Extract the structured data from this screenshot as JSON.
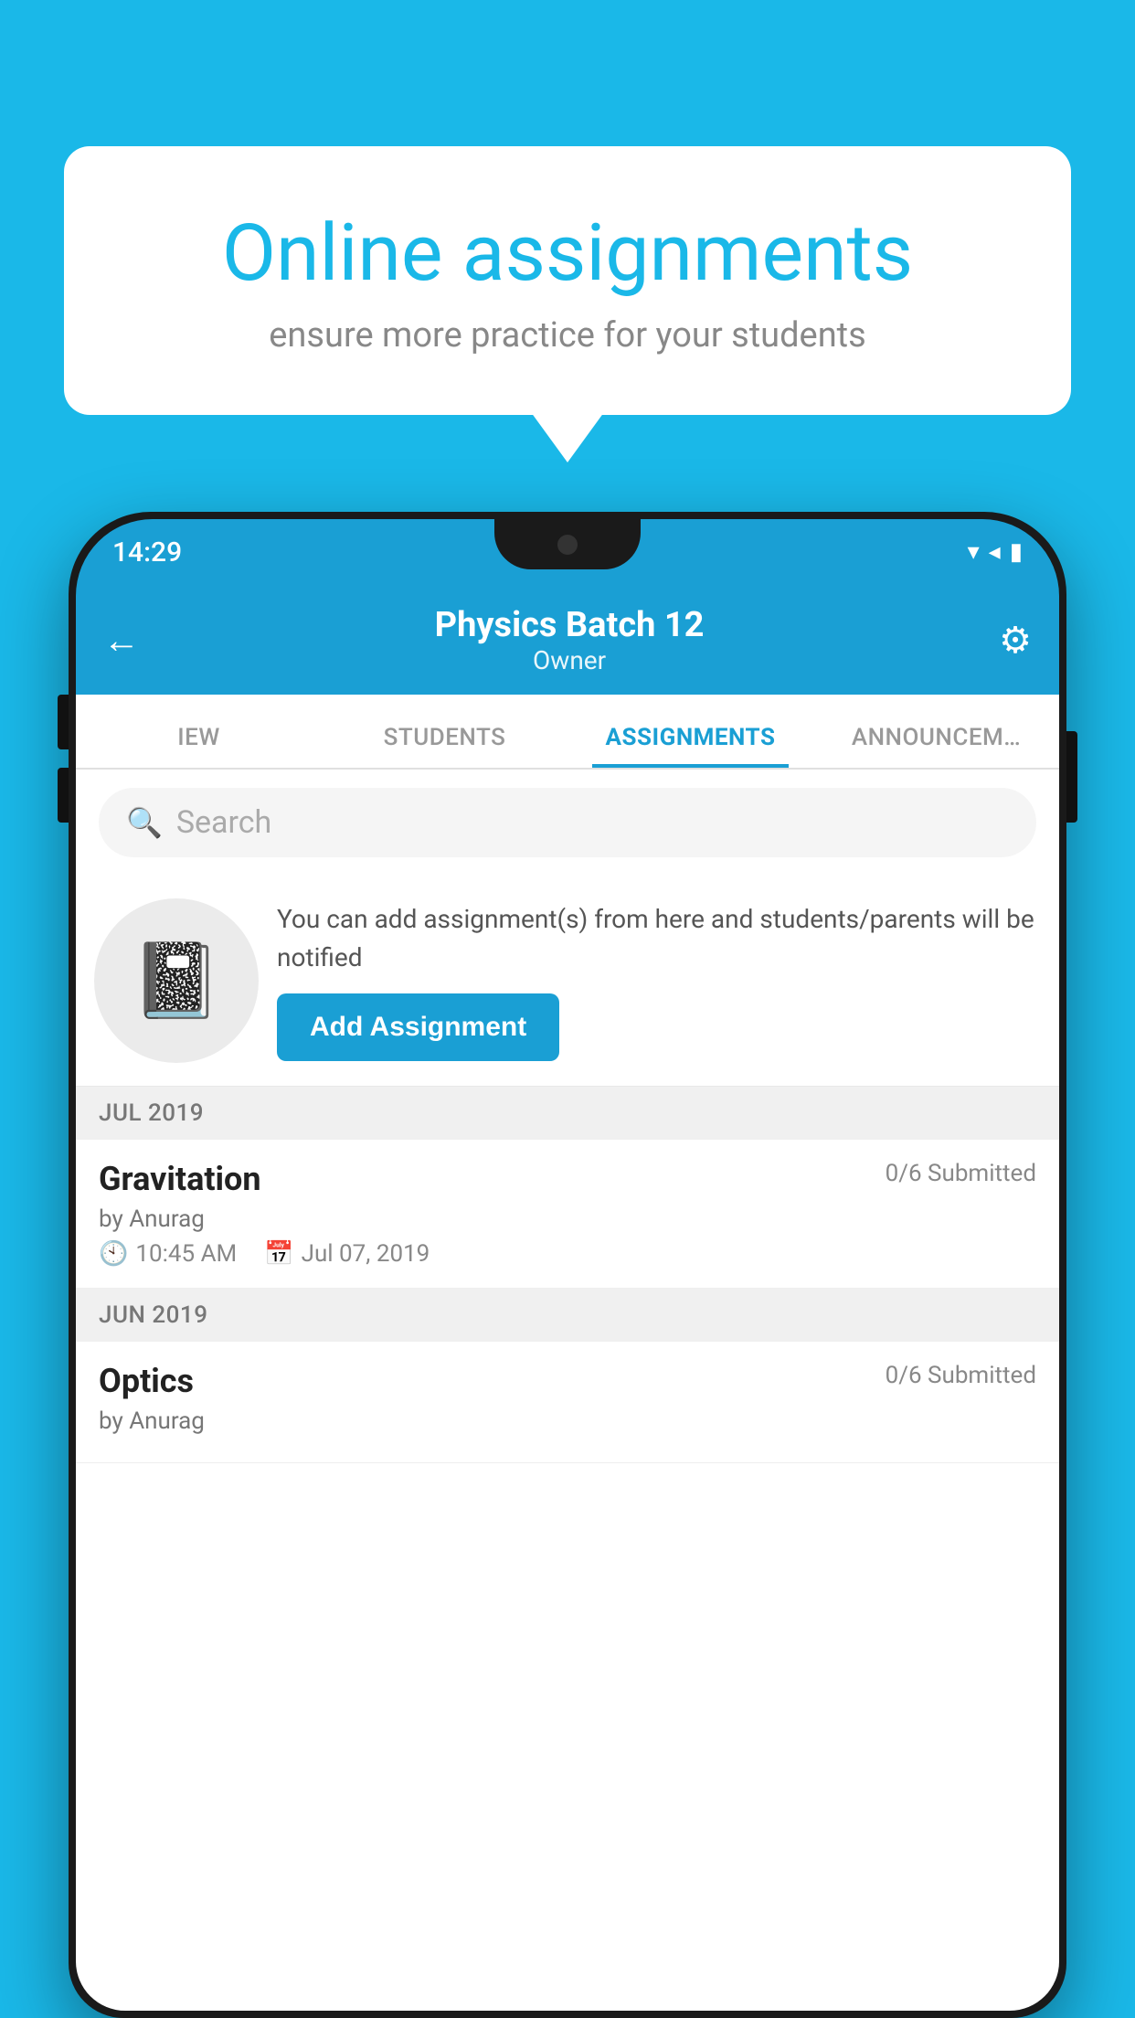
{
  "background": {
    "color": "#1ab8e8"
  },
  "speech_bubble": {
    "title": "Online assignments",
    "subtitle": "ensure more practice for your students"
  },
  "status_bar": {
    "time": "14:29",
    "wifi": "▾",
    "signal": "▲",
    "battery": "▮"
  },
  "header": {
    "title": "Physics Batch 12",
    "subtitle": "Owner",
    "back_label": "←",
    "settings_label": "⚙"
  },
  "tabs": [
    {
      "label": "IEW",
      "active": false
    },
    {
      "label": "STUDENTS",
      "active": false
    },
    {
      "label": "ASSIGNMENTS",
      "active": true
    },
    {
      "label": "ANNOUNCEM…",
      "active": false
    }
  ],
  "search": {
    "placeholder": "Search"
  },
  "promo": {
    "text": "You can add assignment(s) from here and students/parents will be notified",
    "button_label": "Add Assignment"
  },
  "sections": [
    {
      "label": "JUL 2019",
      "assignments": [
        {
          "name": "Gravitation",
          "submitted": "0/6 Submitted",
          "by": "by Anurag",
          "time": "10:45 AM",
          "date": "Jul 07, 2019"
        }
      ]
    },
    {
      "label": "JUN 2019",
      "assignments": [
        {
          "name": "Optics",
          "submitted": "0/6 Submitted",
          "by": "by Anurag",
          "time": "",
          "date": ""
        }
      ]
    }
  ]
}
